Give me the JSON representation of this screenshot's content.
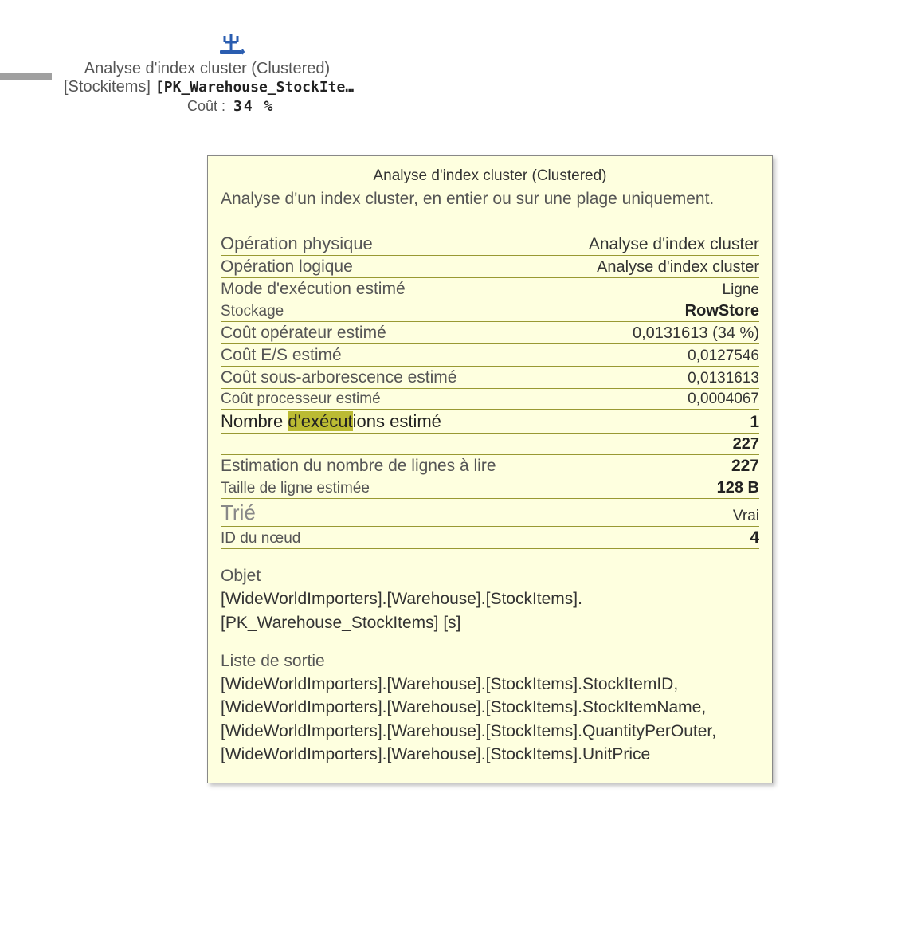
{
  "node": {
    "title": "Analyse d'index cluster (Clustered)",
    "table": "[Stockitems]",
    "index": "[PK_Warehouse_StockIte…",
    "cost_label": "Coût :",
    "cost_value": "34 %"
  },
  "tooltip": {
    "title": "Analyse d'index cluster (Clustered)",
    "description": "Analyse d'un index cluster, en entier ou sur une plage uniquement.",
    "rows": [
      {
        "label": "Opération physique",
        "value": "Analyse d'index cluster",
        "lclass": "fs-22",
        "vclass": "fs-21"
      },
      {
        "label": "Opération logique",
        "value": "Analyse d'index cluster",
        "lclass": "fs-21",
        "vclass": "fs-20"
      },
      {
        "label": "Mode d'exécution estimé",
        "value": "Ligne",
        "lclass": "fs-21",
        "vclass": "fs-19"
      },
      {
        "label": "Stockage",
        "value": "RowStore",
        "lclass": "fs-19",
        "vclass": "fs-20 bold"
      },
      {
        "label": "Coût opérateur estimé",
        "value": "0,0131613 (34 %)",
        "lclass": "fs-21",
        "vclass": "fs-20"
      },
      {
        "label": "Coût E/S estimé",
        "value": "0,0127546",
        "lclass": "fs-21",
        "vclass": "fs-19"
      },
      {
        "label": "Coût sous-arborescence estimé",
        "value": "0,0131613",
        "lclass": "fs-21",
        "vclass": "fs-19"
      },
      {
        "label": "Coût processeur estimé",
        "value": "0,0004067",
        "lclass": "fs-19",
        "vclass": "fs-19"
      }
    ],
    "exec_row": {
      "label_pre": "Nombre ",
      "label_hl": "d'exécut",
      "label_post": "ions estimé",
      "value": "1"
    },
    "rows2": [
      {
        "label": "",
        "value": "227",
        "lclass": "fs-20",
        "vclass": "fs-20 bold"
      },
      {
        "label": "Estimation du nombre de lignes à lire",
        "value": "227",
        "lclass": "fs-21",
        "vclass": "fs-21 bold"
      },
      {
        "label": "Taille de ligne estimée",
        "value": "128 B",
        "lclass": "fs-19",
        "vclass": "fs-20 bold"
      }
    ],
    "trie": {
      "label": "Trié",
      "value": "Vrai"
    },
    "node_id": {
      "label": "ID du nœud",
      "value": "4"
    },
    "object_label": "Objet",
    "object_text": "[WideWorldImporters].[Warehouse].[StockItems].[PK_Warehouse_StockItems] [s]",
    "output_label": "Liste de sortie",
    "output_text": "[WideWorldImporters].[Warehouse].[StockItems].StockItemID, [WideWorldImporters].[Warehouse].[StockItems].StockItemName, [WideWorldImporters].[Warehouse].[StockItems].QuantityPerOuter, [WideWorldImporters].[Warehouse].[StockItems].UnitPrice"
  }
}
